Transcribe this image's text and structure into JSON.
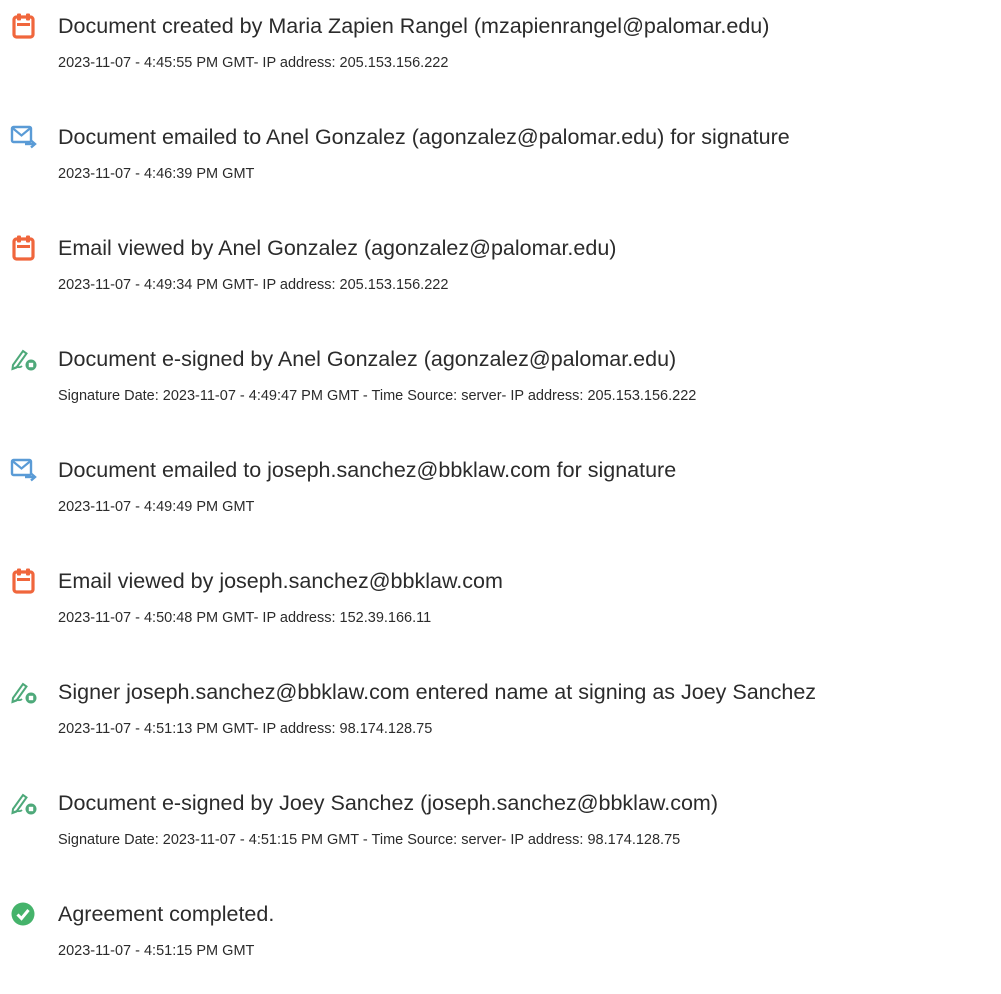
{
  "colors": {
    "doc_icon": "#f0663c",
    "email_icon": "#5a9bd6",
    "sign_icon": "#4ea97a",
    "complete_icon": "#45b36b",
    "text": "#2b2b2b"
  },
  "events": [
    {
      "icon": "document-icon",
      "title": "Document created by Maria Zapien Rangel (mzapienrangel@palomar.edu)",
      "detail": "2023-11-07 - 4:45:55 PM GMT- IP address: 205.153.156.222"
    },
    {
      "icon": "email-icon",
      "title": "Document emailed to Anel Gonzalez (agonzalez@palomar.edu) for signature",
      "detail": "2023-11-07 - 4:46:39 PM GMT"
    },
    {
      "icon": "document-icon",
      "title": "Email viewed by Anel Gonzalez (agonzalez@palomar.edu)",
      "detail": "2023-11-07 - 4:49:34 PM GMT- IP address: 205.153.156.222"
    },
    {
      "icon": "signature-icon",
      "title": "Document e-signed by Anel Gonzalez (agonzalez@palomar.edu)",
      "detail": "Signature Date: 2023-11-07 - 4:49:47 PM GMT - Time Source: server- IP address: 205.153.156.222"
    },
    {
      "icon": "email-icon",
      "title": "Document emailed to joseph.sanchez@bbklaw.com for signature",
      "detail": "2023-11-07 - 4:49:49 PM GMT"
    },
    {
      "icon": "document-icon",
      "title": "Email viewed by joseph.sanchez@bbklaw.com",
      "detail": "2023-11-07 - 4:50:48 PM GMT- IP address: 152.39.166.11"
    },
    {
      "icon": "signature-icon",
      "title": "Signer joseph.sanchez@bbklaw.com entered name at signing as Joey Sanchez",
      "detail": "2023-11-07 - 4:51:13 PM GMT- IP address: 98.174.128.75"
    },
    {
      "icon": "signature-icon",
      "title": "Document e-signed by Joey Sanchez (joseph.sanchez@bbklaw.com)",
      "detail": "Signature Date: 2023-11-07 - 4:51:15 PM GMT - Time Source: server- IP address: 98.174.128.75"
    },
    {
      "icon": "check-circle-icon",
      "title": "Agreement completed.",
      "detail": "2023-11-07 - 4:51:15 PM GMT"
    }
  ]
}
